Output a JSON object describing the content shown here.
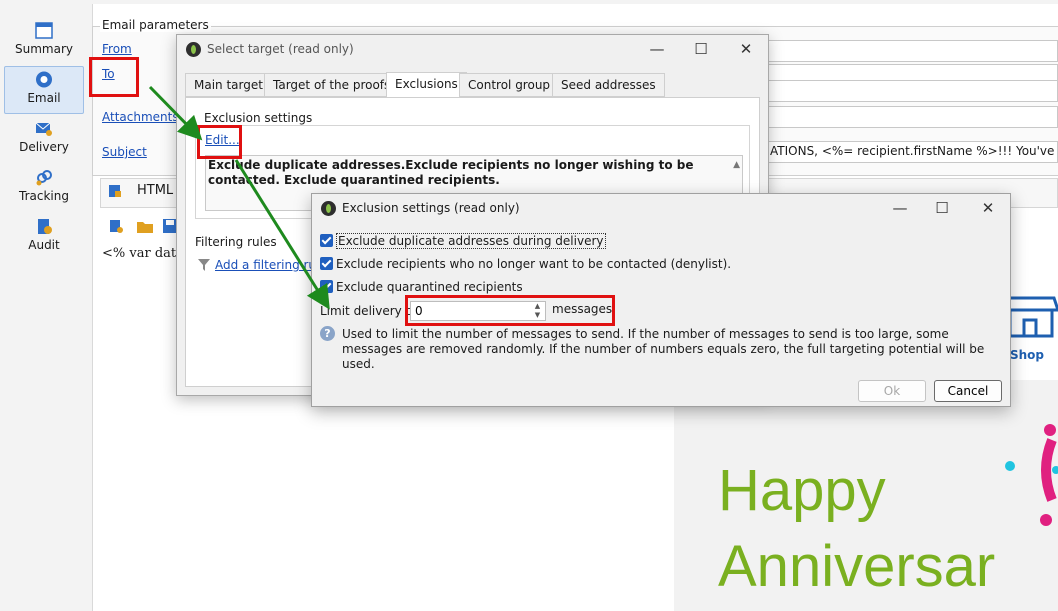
{
  "nav": {
    "items": [
      {
        "label": "Summary",
        "icon": "window-icon"
      },
      {
        "label": "Email",
        "icon": "email-circle-icon",
        "active": true
      },
      {
        "label": "Delivery",
        "icon": "envelope-person-icon"
      },
      {
        "label": "Tracking",
        "icon": "link-chain-icon"
      },
      {
        "label": "Audit",
        "icon": "document-warning-icon"
      }
    ]
  },
  "email_params": {
    "title": "Email parameters",
    "from": "From",
    "to": "To",
    "attachments": "Attachments",
    "subject": "Subject",
    "subject_value": "ATIONS, <%= recipient.firstName %>!!! You've Earned $"
  },
  "content": {
    "html_label": "HTML c",
    "code_preview": "<% var date"
  },
  "promo": {
    "shop": "Shop",
    "happy": "Happy",
    "anniversary": "Anniversar"
  },
  "dialog_target": {
    "title": "Select target (read only)",
    "tabs": [
      "Main target",
      "Target of the proofs",
      "Exclusions",
      "Control group",
      "Seed addresses"
    ],
    "selected_tab": "Exclusions",
    "exclusion_settings_title": "Exclusion settings",
    "edit_link": "Edit...",
    "summary": "Exclude duplicate addresses.Exclude recipients no longer wishing to be contacted. Exclude quarantined recipients.",
    "filtering_rules_title": "Filtering rules",
    "add_filter_link": "Add a filtering rule"
  },
  "dialog_exclusion": {
    "title": "Exclusion settings (read only)",
    "checkboxes": [
      {
        "label": "Exclude duplicate addresses during delivery",
        "checked": true
      },
      {
        "label": "Exclude recipients who no longer want to be contacted (denylist).",
        "checked": true
      },
      {
        "label": "Exclude quarantined recipients",
        "checked": true
      }
    ],
    "limit_label": "Limit delivery to",
    "limit_value": "0",
    "messages_label": "messages",
    "info": "Used to limit the number of messages to send. If the number of messages to send is too large, some messages are removed randomly. If the number of numbers equals zero, the full targeting potential will be used.",
    "ok": "Ok",
    "cancel": "Cancel"
  },
  "colors": {
    "accent_blue": "#1f5fbf",
    "highlight_red": "#e01010",
    "arrow_green": "#1e8a1e",
    "promo_green": "#7ab020"
  }
}
